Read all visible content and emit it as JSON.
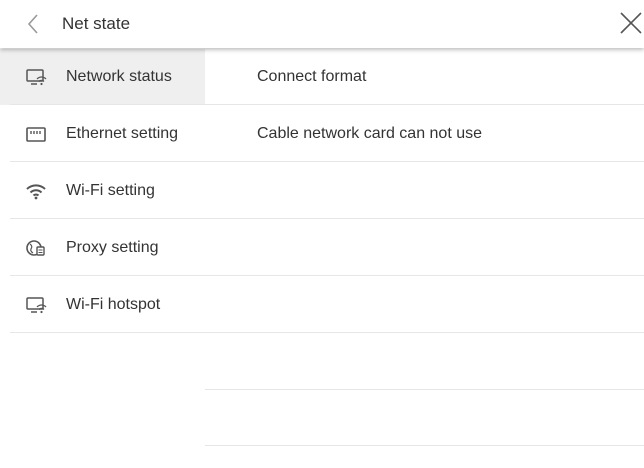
{
  "header": {
    "title": "Net state",
    "icons": {
      "back": "back-chevron-icon",
      "close": "close-icon"
    }
  },
  "sidebar": {
    "items": [
      {
        "label": "Network status",
        "icon": "monitor-wifi-icon",
        "active": true
      },
      {
        "label": "Ethernet setting",
        "icon": "ethernet-port-icon",
        "active": false
      },
      {
        "label": "Wi-Fi setting",
        "icon": "wifi-icon",
        "active": false
      },
      {
        "label": "Proxy setting",
        "icon": "globe-proxy-icon",
        "active": false
      },
      {
        "label": "Wi-Fi hotspot",
        "icon": "hotspot-icon",
        "active": false
      }
    ]
  },
  "content": {
    "rows": [
      {
        "text": "Connect format"
      },
      {
        "text": "Cable network card can not use"
      },
      {
        "text": ""
      },
      {
        "text": ""
      },
      {
        "text": ""
      },
      {
        "text": ""
      },
      {
        "text": ""
      }
    ]
  },
  "colors": {
    "active_bg": "#efefef",
    "divider": "#e6e6e6",
    "text": "#333333",
    "icon": "#555555"
  }
}
